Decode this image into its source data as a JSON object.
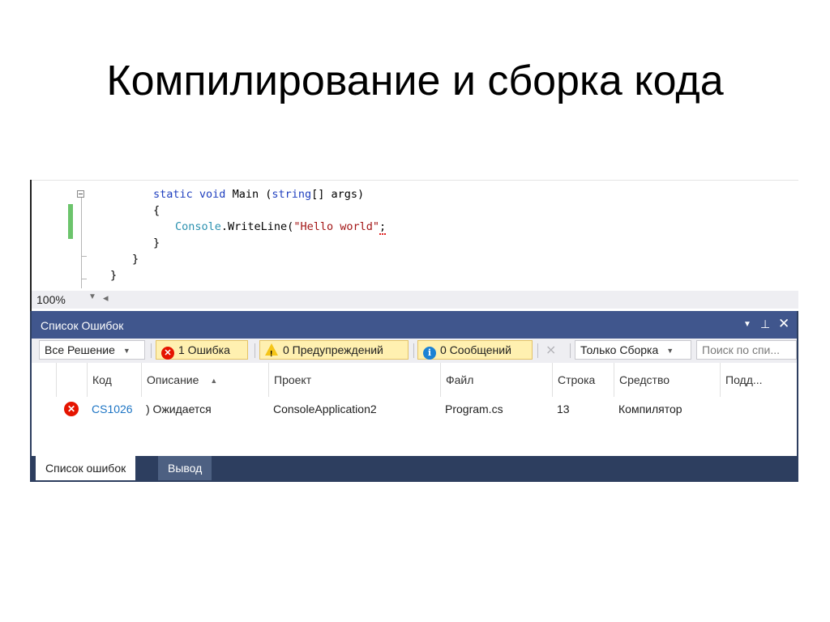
{
  "slide": {
    "title": "Компилирование и сборка кода"
  },
  "code": {
    "line1_static": "static",
    "line1_void": "void",
    "line1_main": "Main (",
    "line1_string": "string",
    "line1_rest": "[] args)",
    "line2": "{",
    "line3_console": "Console",
    "line3_mid": ".WriteLine(",
    "line3_str": "\"Hello world\"",
    "line3_end": ";",
    "line4": "}",
    "line5": "}",
    "line6": "}"
  },
  "editor": {
    "zoom": "100%"
  },
  "error_list": {
    "title": "Список Ошибок",
    "toolbar": {
      "scope": "Все Решение",
      "errors": "1 Ошибка",
      "warnings": "0 Предупреждений",
      "messages": "0 Сообщений",
      "build_filter": "Только Сборка",
      "search_placeholder": "Поиск по спи..."
    },
    "columns": [
      "Код",
      "Описание",
      "Проект",
      "Файл",
      "Строка",
      "Средство",
      "Подд..."
    ],
    "rows": [
      {
        "code": "CS1026",
        "description": ") Ожидается",
        "project": "ConsoleApplication2",
        "file": "Program.cs",
        "line": "13",
        "tool": "Компилятор",
        "suppression": ""
      }
    ]
  },
  "tabs": {
    "errors": "Список ошибок",
    "output": "Вывод"
  },
  "colors": {
    "accent": "#40568d",
    "error": "#e51400",
    "warning": "#f5c518",
    "info": "#1c82d4",
    "change_bar": "#6cc46c"
  }
}
